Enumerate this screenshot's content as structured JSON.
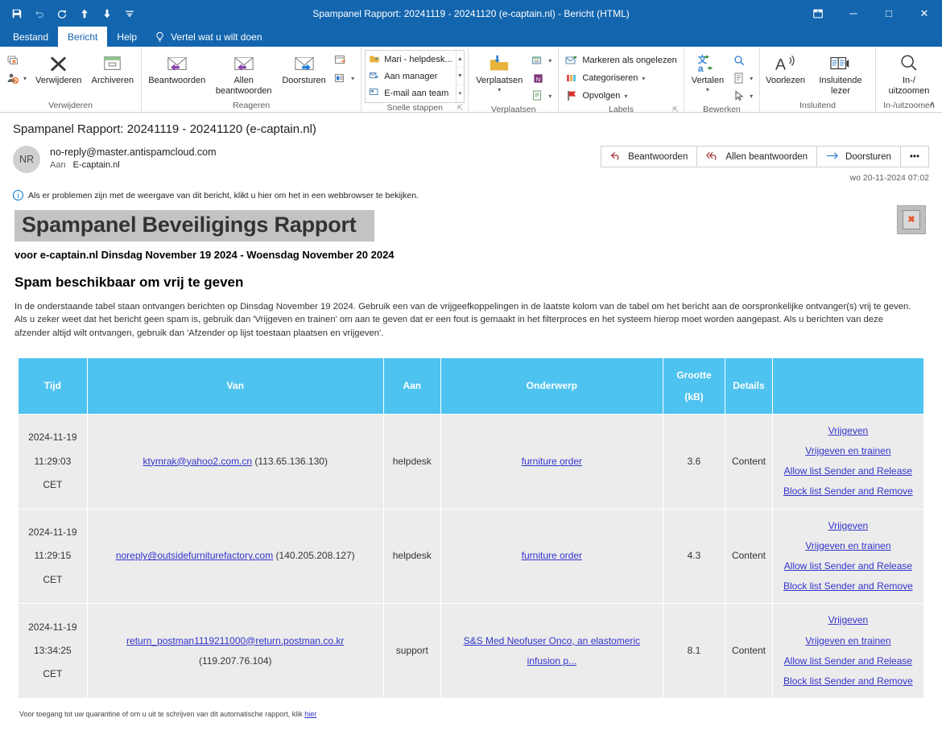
{
  "window": {
    "title": "Spampanel Rapport: 20241119 - 20241120 (e-captain.nl)  -  Bericht (HTML)",
    "quick_access": [
      {
        "name": "save-icon",
        "label": "Opslaan"
      },
      {
        "name": "undo-icon",
        "label": "Ongedaan maken"
      },
      {
        "name": "redo-icon",
        "label": "Opnieuw"
      },
      {
        "name": "previous-item-icon",
        "label": "Vorige item"
      },
      {
        "name": "next-item-icon",
        "label": "Volgende item"
      },
      {
        "name": "customize-quick-access-icon",
        "label": "Werkbalk Snelle toegang aanpassen"
      }
    ],
    "controls": [
      {
        "name": "ribbon-display-options",
        "glyph": "⌷"
      },
      {
        "name": "minimize",
        "glyph": "─"
      },
      {
        "name": "maximize",
        "glyph": "□"
      },
      {
        "name": "close",
        "glyph": "✕"
      }
    ]
  },
  "tabs": [
    {
      "label": "Bestand",
      "active": false
    },
    {
      "label": "Bericht",
      "active": true
    },
    {
      "label": "Help",
      "active": false
    }
  ],
  "tell_me": "Vertel wat u wilt doen",
  "ribbon": {
    "collapse_label": "∧",
    "groups": [
      {
        "label": "Verwijderen",
        "items": [
          {
            "label": "Negeren",
            "icon": "ignore-icon",
            "type": "small"
          },
          {
            "label": "Ongewenste e-mail",
            "icon": "junk-icon",
            "type": "small"
          },
          {
            "label": "Verwijderen",
            "icon": "delete-icon",
            "type": "big"
          },
          {
            "label": "Archiveren",
            "icon": "archive-icon",
            "type": "big"
          }
        ]
      },
      {
        "label": "Reageren",
        "items": [
          {
            "label": "Beantwoorden",
            "icon": "reply-icon",
            "type": "big"
          },
          {
            "label": "Allen beantwoorden",
            "icon": "reply-all-icon",
            "type": "big"
          },
          {
            "label": "Doorsturen",
            "icon": "forward-icon",
            "type": "big"
          },
          {
            "label": "Meer reageer-opties",
            "icon": "meeting-icon",
            "type": "small"
          },
          {
            "label": "Meer",
            "icon": "more-reply-icon",
            "type": "small"
          }
        ]
      },
      {
        "label": "Snelle stappen",
        "dialog_launcher": true,
        "quick_steps": [
          {
            "label": "Mari - helpdesk...",
            "icon": "quickstep-move-icon"
          },
          {
            "label": "Aan manager",
            "icon": "quickstep-manager-icon"
          },
          {
            "label": "E-mail aan team",
            "icon": "quickstep-team-icon"
          }
        ]
      },
      {
        "label": "Verplaatsen",
        "items": [
          {
            "label": "Verplaatsen",
            "icon": "move-folder-icon",
            "type": "big"
          },
          {
            "label": "Regels",
            "icon": "rules-icon",
            "type": "small"
          },
          {
            "label": "OneNote",
            "icon": "onenote-icon",
            "type": "small"
          },
          {
            "label": "Acties",
            "icon": "actions-icon",
            "type": "small"
          }
        ]
      },
      {
        "label": "Labels",
        "dialog_launcher": true,
        "items": [
          {
            "label": "Markeren als ongelezen",
            "icon": "mark-unread-icon",
            "type": "small"
          },
          {
            "label": "Categoriseren",
            "icon": "categorize-icon",
            "type": "small"
          },
          {
            "label": "Opvolgen",
            "icon": "follow-up-flag-icon",
            "type": "small"
          }
        ]
      },
      {
        "label": "Bewerken",
        "items": [
          {
            "label": "Vertalen",
            "icon": "translate-icon",
            "type": "big"
          },
          {
            "label": "Zoeken",
            "icon": "find-icon",
            "type": "small"
          },
          {
            "label": "Selecteren",
            "icon": "select-icon",
            "type": "small"
          },
          {
            "label": "Aanwijzer",
            "icon": "pointer-icon",
            "type": "small"
          }
        ]
      },
      {
        "label": "Insluitend",
        "items": [
          {
            "label": "Voorlezen",
            "icon": "read-aloud-icon",
            "type": "big"
          },
          {
            "label": "Insluitende lezer",
            "icon": "immersive-reader-icon",
            "type": "big"
          }
        ]
      },
      {
        "label": "In-/uitzoomen",
        "items": [
          {
            "label": "In-/ uitzoomen",
            "icon": "zoom-icon",
            "type": "big"
          }
        ]
      }
    ]
  },
  "message": {
    "subject": "Spampanel Rapport: 20241119 - 20241120 (e-captain.nl)",
    "avatar_initials": "NR",
    "sender": "no-reply@master.antispamcloud.com",
    "to_label": "Aan",
    "to_value": "E-captain.nl",
    "timestamp": "wo 20-11-2024 07:02",
    "actions": [
      {
        "label": "Beantwoorden",
        "icon": "reply-icon"
      },
      {
        "label": "Allen beantwoorden",
        "icon": "reply-all-icon"
      },
      {
        "label": "Doorsturen",
        "icon": "forward-icon"
      },
      {
        "label": "•••",
        "icon": "more-actions-icon"
      }
    ],
    "infobar": "Als er problemen zijn met de weergave van dit bericht, klikt u hier om het in een webbrowser te bekijken."
  },
  "report": {
    "banner_title": "Spampanel Beveiligings Rapport",
    "subtitle": "voor e-captain.nl Dinsdag November 19 2024 - Woensdag November 20 2024",
    "section_title": "Spam beschikbaar om vrij te geven",
    "intro": "In de onderstaande tabel staan ontvangen berichten op Dinsdag November 19 2024. Gebruik een van de vrijgeefkoppelingen in de laatste kolom van de tabel om het bericht aan de oorspronkelijke ontvanger(s) vrij te geven. Als u zeker weet dat het bericht geen spam is, gebruik dan 'Vrijgeven en trainen' om aan te geven dat er een fout is gemaakt in het filterproces en het systeem hierop moet worden aangepast. Als u berichten van deze afzender altijd wilt ontvangen, gebruik dan 'Afzender op lijst toestaan plaatsen en vrijgeven'.",
    "columns": [
      "Tijd",
      "Van",
      "Aan",
      "Onderwerp",
      "Grootte (kB)",
      "Details",
      ""
    ],
    "column_grootte_line1": "Grootte",
    "column_grootte_line2": "(kB)",
    "rows": [
      {
        "tijd": "2024-11-19 11:29:03 CET",
        "from_email": "ktymrak@yahoo2.com.cn",
        "from_ip": "(113.65.136.130)",
        "aan": "helpdesk",
        "onderwerp": "furniture order",
        "grootte": "3.6",
        "details": "Content",
        "acties": [
          "Vrijgeven",
          "Vrijgeven en trainen",
          "Allow list Sender and Release",
          "Block list Sender and Remove"
        ]
      },
      {
        "tijd": "2024-11-19 11:29:15 CET",
        "from_email": "noreply@outsidefurniturefactory.com",
        "from_ip": "(140.205.208.127)",
        "aan": "helpdesk",
        "onderwerp": "furniture order",
        "grootte": "4.3",
        "details": "Content",
        "acties": [
          "Vrijgeven",
          "Vrijgeven en trainen",
          "Allow list Sender and Release",
          "Block list Sender and Remove"
        ]
      },
      {
        "tijd": "2024-11-19 13:34:25 CET",
        "from_email": "return_postman1119211000@return.postman.co.kr",
        "from_ip": "(119.207.76.104)",
        "aan": "support",
        "onderwerp": "S&S Med   Neofuser Onco, an elastomeric infusion p...",
        "grootte": "8.1",
        "details": "Content",
        "acties": [
          "Vrijgeven",
          "Vrijgeven en trainen",
          "Allow list Sender and Release",
          "Block list Sender and Remove"
        ]
      }
    ],
    "footnote_text": "Voor toegang tot uw quarantine of om u uit te schrijven van dit automatische rapport, klik ",
    "footnote_link": "hier"
  },
  "colors": {
    "titlebar": "#1365ae",
    "table_header": "#4ec3f0",
    "table_row": "#ececec",
    "link": "#3333cc",
    "banner_bg": "#c3c3c3"
  }
}
